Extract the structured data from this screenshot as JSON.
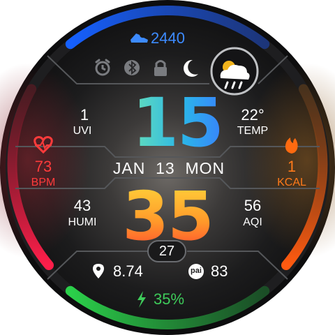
{
  "steps": {
    "value": "2440",
    "icon": "shoe-icon"
  },
  "status_icons": [
    "alarm-icon",
    "bluetooth-icon",
    "lock-icon",
    "moon-icon"
  ],
  "weather": {
    "icon": "cloud-sun-rain-icon"
  },
  "time": {
    "hour": "15",
    "minute": "35"
  },
  "date": {
    "text": "JAN  13  MON"
  },
  "left_top": {
    "value": "1",
    "label": "UVI"
  },
  "right_top": {
    "value": "22°",
    "label": "TEMP"
  },
  "heart": {
    "value": "73",
    "label": "BPM",
    "icon": "heart-icon"
  },
  "calories": {
    "value": "1",
    "label": "KCAL",
    "icon": "flame-icon"
  },
  "left_bottom": {
    "value": "43",
    "label": "HUMI"
  },
  "right_bottom": {
    "value": "56",
    "label": "AQI"
  },
  "seconds": {
    "value": "27"
  },
  "distance": {
    "value": "8.74",
    "icon": "location-pin-icon"
  },
  "pai": {
    "badge": "pai",
    "value": "83"
  },
  "battery": {
    "value": "35%",
    "icon": "lightning-icon"
  },
  "colors": {
    "steps_arc": "#1a63e8",
    "heart_arc": "#e8234a",
    "calories_arc": "#ff5a0f",
    "battery_arc": "#2aa84a",
    "calories_text": "#ff7a1a",
    "heart_text": "#ff3b3b",
    "steps_text": "#3d8bff",
    "battery_text": "#3ecb5a"
  }
}
